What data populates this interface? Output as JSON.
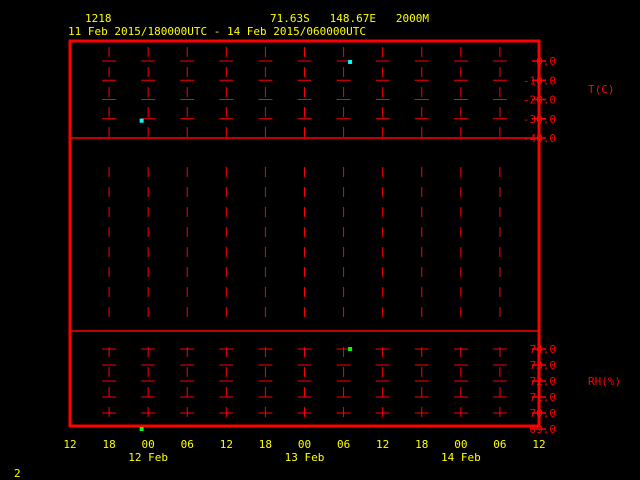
{
  "header": {
    "station_id": "1218",
    "location": "71.63S   148.67E   2000M",
    "time_range": "11 Feb 2015/180000UTC - 14 Feb 2015/060000UTC"
  },
  "footer": {
    "page": "2"
  },
  "colors": {
    "frame": "#ff0000",
    "text": "#ffff00",
    "temperature": "#00ffff",
    "rh": "#00ff00"
  },
  "chart_data": [
    {
      "type": "scatter",
      "title": "T(C)",
      "ylabel": "T(C)",
      "ylim": [
        -40,
        0
      ],
      "yticks": [
        "0.0",
        "-10.0",
        "-20.0",
        "-30.0",
        "-40.0"
      ],
      "x_hours_from_11Feb12UTC": [
        11,
        43
      ],
      "values": [
        -31,
        -0.5
      ]
    },
    {
      "type": "scatter",
      "title": "RH(%)",
      "ylabel": "RH(%)",
      "ylim": [
        69,
        74
      ],
      "yticks": [
        "74.0",
        "73.0",
        "72.0",
        "71.0",
        "70.0",
        "69.0"
      ],
      "x_hours_from_11Feb12UTC": [
        11,
        43
      ],
      "values": [
        69,
        74
      ]
    }
  ],
  "xaxis": {
    "range_hours": [
      0,
      72
    ],
    "tick_labels": [
      "12",
      "18",
      "00",
      "06",
      "12",
      "18",
      "00",
      "06",
      "12",
      "18",
      "00",
      "06",
      "12"
    ],
    "date_labels": [
      {
        "label": "12 Feb",
        "hour": 12
      },
      {
        "label": "13 Feb",
        "hour": 36
      },
      {
        "label": "14 Feb",
        "hour": 60
      }
    ]
  }
}
